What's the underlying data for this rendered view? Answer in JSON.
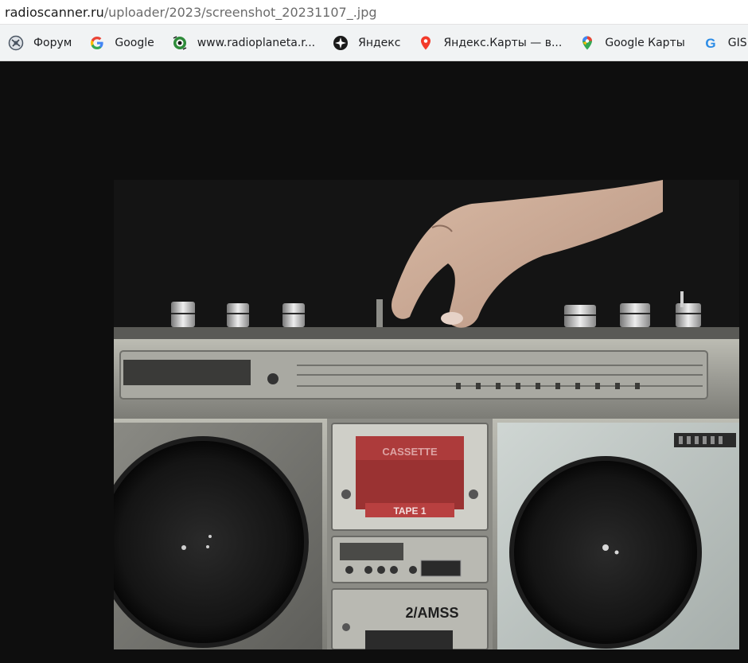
{
  "address_bar": {
    "domain": "radioscanner.ru",
    "path": "/uploader/2023/screenshot_20231107_.jpg"
  },
  "bookmarks": [
    {
      "label": "Форум",
      "icon": "forum-favicon-icon"
    },
    {
      "label": "Google",
      "icon": "google-g-icon"
    },
    {
      "label": "www.radioplaneta.r...",
      "icon": "radioplaneta-favicon-icon"
    },
    {
      "label": "Яндекс",
      "icon": "yandex-compass-icon"
    },
    {
      "label": "Яндекс.Карты — в...",
      "icon": "yandex-maps-pin-icon"
    },
    {
      "label": "Google Карты",
      "icon": "google-maps-pin-icon"
    },
    {
      "label": "GISMETEO: п",
      "icon": "gismeteo-g-icon"
    }
  ],
  "image": {
    "alt_semantic": "boombox-cassette-player-photo",
    "tape_label": "TAPE 1",
    "model_text": "2/AMSS"
  },
  "colors": {
    "page_background": "#0e0e0e",
    "bookmarks_background": "#f1f3f4",
    "address_background": "#ffffff"
  }
}
